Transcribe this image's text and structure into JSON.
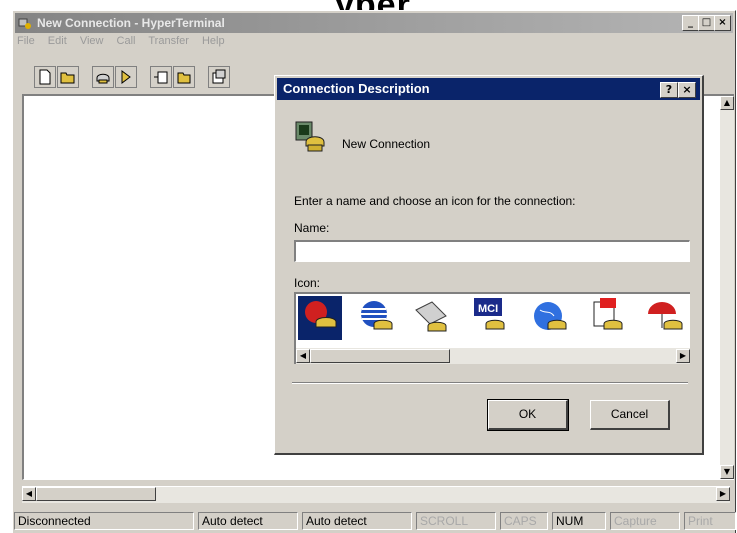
{
  "header_fragment": "yper",
  "window": {
    "title": "New Connection - HyperTerminal",
    "controls": {
      "minimize": "_",
      "maximize": "□",
      "close": "×"
    }
  },
  "menu": {
    "items": [
      {
        "label": "File"
      },
      {
        "label": "Edit"
      },
      {
        "label": "View"
      },
      {
        "label": "Call"
      },
      {
        "label": "Transfer"
      },
      {
        "label": "Help"
      }
    ]
  },
  "toolbar": {
    "buttons": [
      "new-icon",
      "open-icon",
      "connect-icon",
      "disconnect-icon",
      "send-icon",
      "receive-icon",
      "properties-icon"
    ]
  },
  "dialog": {
    "title": "Connection Description",
    "help_btn": "?",
    "close_btn": "×",
    "heading": "New Connection",
    "instruction": "Enter a name and choose an icon for the connection:",
    "name_label": "Name:",
    "name_value": "",
    "icon_label": "Icon:",
    "icons": [
      "phone-red-icon",
      "globe-striped-icon",
      "fax-icon",
      "mci-icon",
      "globe-blue-icon",
      "document-icon",
      "umbrella-icon"
    ],
    "icon_text_mci": "MCI",
    "ok": "OK",
    "cancel": "Cancel"
  },
  "status": {
    "connection": "Disconnected",
    "detect1": "Auto detect",
    "detect2": "Auto detect",
    "scroll": "SCROLL",
    "caps": "CAPS",
    "num": "NUM",
    "capture": "Capture",
    "print": "Print"
  },
  "colors": {
    "dialog_title": "#0a246a",
    "window_title": "#848484",
    "face": "#d4d0c8"
  }
}
